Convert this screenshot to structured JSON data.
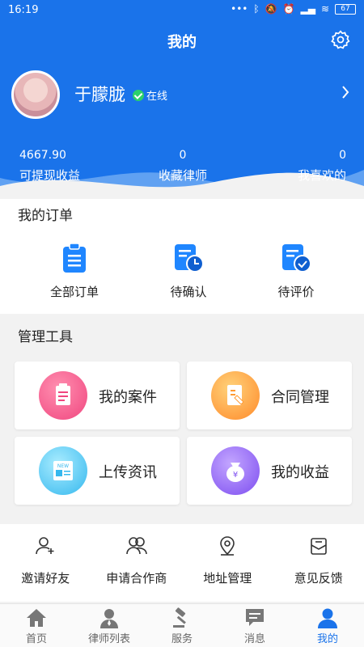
{
  "status_bar": {
    "time": "16:19",
    "battery": "67"
  },
  "header": {
    "title": "我的",
    "user": {
      "name": "于朦胧",
      "status": "在线"
    },
    "stats": [
      {
        "value": "4667.90",
        "label": "可提现收益"
      },
      {
        "value": "0",
        "label": "收藏律师"
      },
      {
        "value": "0",
        "label": "我喜欢的"
      }
    ]
  },
  "orders": {
    "title": "我的订单",
    "items": [
      {
        "label": "全部订单",
        "icon": "clipboard-list-icon"
      },
      {
        "label": "待确认",
        "icon": "document-clock-icon"
      },
      {
        "label": "待评价",
        "icon": "document-check-icon"
      }
    ]
  },
  "tools": {
    "title": "管理工具",
    "cards": [
      {
        "label": "我的案件",
        "icon": "case-icon",
        "color": "#f0467f"
      },
      {
        "label": "合同管理",
        "icon": "contract-icon",
        "color": "#ffa83a"
      },
      {
        "label": "上传资讯",
        "icon": "news-icon",
        "color": "#3fc3f0"
      },
      {
        "label": "我的收益",
        "icon": "money-bag-icon",
        "color": "#8a5cf0"
      }
    ]
  },
  "quick_links": [
    {
      "label": "邀请好友",
      "icon": "invite-friend-icon"
    },
    {
      "label": "申请合作商",
      "icon": "partner-icon"
    },
    {
      "label": "地址管理",
      "icon": "location-icon"
    },
    {
      "label": "意见反馈",
      "icon": "feedback-icon"
    }
  ],
  "tabbar": [
    {
      "label": "首页",
      "icon": "home-icon"
    },
    {
      "label": "律师列表",
      "icon": "lawyer-icon"
    },
    {
      "label": "服务",
      "icon": "gavel-icon"
    },
    {
      "label": "消息",
      "icon": "message-icon"
    },
    {
      "label": "我的",
      "icon": "user-icon",
      "active": true
    }
  ],
  "colors": {
    "primary": "#1a73ea"
  }
}
